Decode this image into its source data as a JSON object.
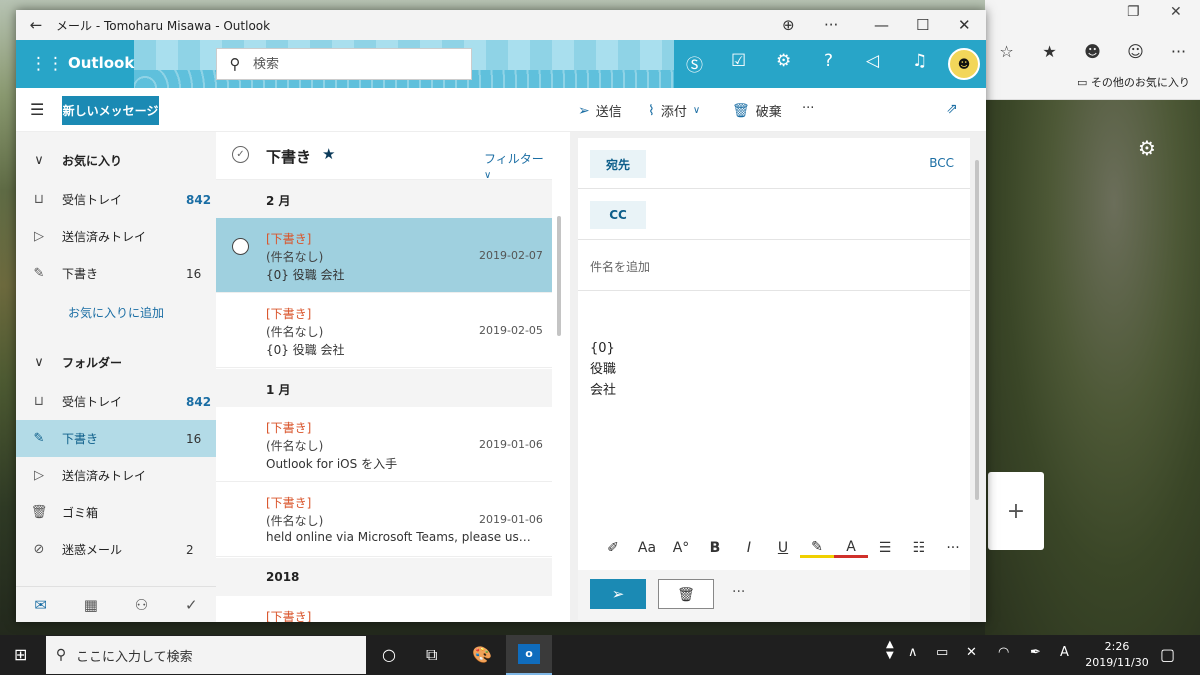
{
  "window": {
    "title": "メール - Tomoharu Misawa - Outlook"
  },
  "header": {
    "brand": "Outlook",
    "search_placeholder": "検索"
  },
  "toolbar": {
    "new_message": "新しいメッセージ",
    "send": "送信",
    "attach": "添付",
    "discard": "破棄",
    "more": "···"
  },
  "nav": {
    "favorites": "お気に入り",
    "fav_items": [
      {
        "label": "受信トレイ",
        "count": "842"
      },
      {
        "label": "送信済みトレイ",
        "count": ""
      },
      {
        "label": "下書き",
        "count": "16"
      }
    ],
    "add_favorite": "お気に入りに追加",
    "folders": "フォルダー",
    "folder_items": [
      {
        "label": "受信トレイ",
        "count": "842"
      },
      {
        "label": "下書き",
        "count": "16"
      },
      {
        "label": "送信済みトレイ",
        "count": ""
      },
      {
        "label": "ゴミ箱",
        "count": ""
      },
      {
        "label": "迷惑メール",
        "count": "2"
      }
    ]
  },
  "list": {
    "title": "下書き",
    "filter": "フィルター",
    "groups": [
      "2 月",
      "1 月",
      "2018"
    ],
    "messages": [
      {
        "tag": "[下書き]",
        "subject": "(件名なし)",
        "date": "2019-02-07",
        "preview": "{0} 役職 会社"
      },
      {
        "tag": "[下書き]",
        "subject": "(件名なし)",
        "date": "2019-02-05",
        "preview": "{0} 役職 会社"
      },
      {
        "tag": "[下書き]",
        "subject": "(件名なし)",
        "date": "2019-01-06",
        "preview": "Outlook for iOS を入手"
      },
      {
        "tag": "[下書き]",
        "subject": "(件名なし)",
        "date": "2019-01-06",
        "preview": "held online via Microsoft Teams, please use t..."
      },
      {
        "tag": "[下書き]",
        "subject": "",
        "date": "",
        "preview": ""
      }
    ]
  },
  "compose": {
    "to": "宛先",
    "cc": "CC",
    "bcc": "BCC",
    "subject_placeholder": "件名を追加",
    "body": [
      "{0}",
      "役職",
      "会社"
    ]
  },
  "browser": {
    "favorites_bar": "その他のお気に入り"
  },
  "taskbar": {
    "search": "ここに入力して検索",
    "time": "2:26",
    "date": "2019/11/30"
  }
}
